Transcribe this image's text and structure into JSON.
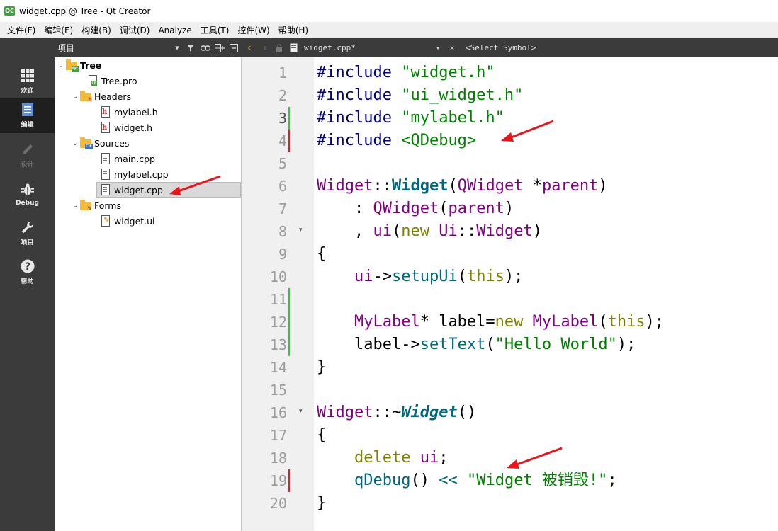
{
  "window": {
    "logo": "QC",
    "title": "widget.cpp @ Tree - Qt Creator"
  },
  "menu": [
    "文件(F)",
    "编辑(E)",
    "构建(B)",
    "调试(D)",
    "Analyze",
    "工具(T)",
    "控件(W)",
    "帮助(H)"
  ],
  "modes": [
    {
      "label": "欢迎",
      "icon": "grid-icon"
    },
    {
      "label": "编辑",
      "icon": "edit-doc-icon"
    },
    {
      "label": "设计",
      "icon": "pencil-icon"
    },
    {
      "label": "Debug",
      "icon": "bug-icon"
    },
    {
      "label": "项目",
      "icon": "wrench-icon"
    },
    {
      "label": "帮助",
      "icon": "help-icon"
    }
  ],
  "project_panel": {
    "title": "项目",
    "tree": [
      {
        "label": "Tree"
      },
      {
        "label": "Tree.pro"
      },
      {
        "label": "Headers"
      },
      {
        "label": "mylabel.h"
      },
      {
        "label": "widget.h"
      },
      {
        "label": "Sources"
      },
      {
        "label": "main.cpp"
      },
      {
        "label": "mylabel.cpp"
      },
      {
        "label": "widget.cpp"
      },
      {
        "label": "Forms"
      },
      {
        "label": "widget.ui"
      }
    ]
  },
  "editor_toolbar": {
    "file": "widget.cpp*",
    "symbol": "<Select Symbol>"
  },
  "editor": {
    "current_line": 3,
    "line_numbers": [
      "1",
      "2",
      "3",
      "4",
      "5",
      "6",
      "7",
      "8",
      "9",
      "10",
      "11",
      "12",
      "13",
      "14",
      "15",
      "16",
      "17",
      "18",
      "19",
      "20"
    ],
    "code": {
      "l1_a": "#include",
      "l1_b": " \"widget.h\"",
      "l2_a": "#include",
      "l2_b": " \"ui_widget.h\"",
      "l3_a": "#include",
      "l3_b": " \"mylabel.h\"",
      "l4_a": "#include",
      "l4_b": " <QDebug>",
      "l6_a": "Widget",
      "l6_b": "::",
      "l6_c": "Widget",
      "l6_d": "(",
      "l6_e": "QWidget",
      "l6_f": " *",
      "l6_g": "parent",
      "l6_h": ")",
      "l7_a": "    : ",
      "l7_b": "QWidget",
      "l7_c": "(",
      "l7_d": "parent",
      "l7_e": ")",
      "l8_a": "    , ",
      "l8_b": "ui",
      "l8_c": "(",
      "l8_d": "new",
      "l8_e": " Ui",
      "l8_f": "::",
      "l8_g": "Widget",
      "l8_h": ")",
      "l9": "{",
      "l10_a": "    ",
      "l10_b": "ui",
      "l10_c": "->",
      "l10_d": "setupUi",
      "l10_e": "(",
      "l10_f": "this",
      "l10_g": ");",
      "l12_a": "    ",
      "l12_b": "MyLabel",
      "l12_c": "* label=",
      "l12_d": "new",
      "l12_e": " ",
      "l12_f": "MyLabel",
      "l12_g": "(",
      "l12_h": "this",
      "l12_i": ");",
      "l13_a": "    label->",
      "l13_b": "setText",
      "l13_c": "(",
      "l13_d": "\"Hello World\"",
      "l13_e": ");",
      "l14": "}",
      "l16_a": "Widget",
      "l16_b": "::~",
      "l16_c": "Widget",
      "l16_d": "()",
      "l17": "{",
      "l18_a": "    ",
      "l18_b": "delete",
      "l18_c": " ",
      "l18_d": "ui",
      "l18_e": ";",
      "l19_a": "    ",
      "l19_b": "qDebug",
      "l19_c": "() ",
      "l19_d": "<<",
      "l19_e": " ",
      "l19_f": "\"Widget 被销毁!\"",
      "l19_g": ";",
      "l20": "}"
    }
  }
}
